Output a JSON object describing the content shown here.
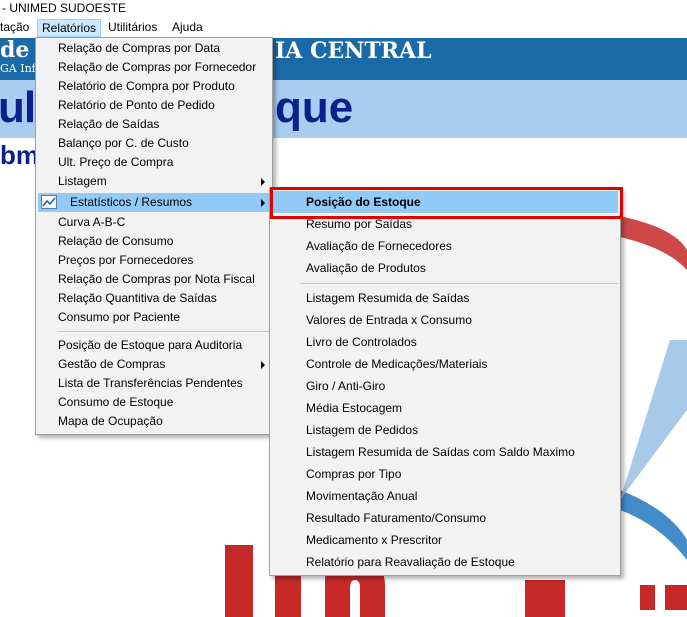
{
  "window": {
    "title": "- UNIMED SUDOESTE"
  },
  "menubar": [
    {
      "label": "tação",
      "active": false
    },
    {
      "label": "Relatórios",
      "active": true
    },
    {
      "label": "Utilitários",
      "active": false
    },
    {
      "label": "Ajuda",
      "active": false
    }
  ],
  "background": {
    "banner_left": "de d",
    "banner_right": "IA CENTRAL",
    "banner_small": "GA Infor",
    "big_left": "ulo",
    "big_right": "que",
    "subtitle": "bm"
  },
  "relatorios_menu": {
    "items": [
      {
        "label": "Relação de Compras por Data"
      },
      {
        "label": "Relação de Compras por Fornecedor"
      },
      {
        "label": "Relatório de Compra por Produto"
      },
      {
        "label": "Relatório de Ponto de Pedido"
      },
      {
        "label": "Relação de Saídas"
      },
      {
        "label": "Balanço por C. de Custo"
      },
      {
        "label": "Ult. Preço de Compra"
      },
      {
        "label": "Listagem",
        "submenu": true
      },
      {
        "label": "Estatísticos / Resumos",
        "submenu": true,
        "highlighted": true,
        "icon": "chart-icon"
      },
      {
        "label": "Curva A-B-C"
      },
      {
        "label": "Relação de Consumo"
      },
      {
        "label": "Preços por Fornecedores"
      },
      {
        "label": "Relação de Compras por Nota Fiscal"
      },
      {
        "label": "Relação Quantitiva de Saídas"
      },
      {
        "label": "Consumo por Paciente"
      },
      {
        "label": "Posição de Estoque para Auditoria"
      },
      {
        "label": "Gestão de Compras",
        "submenu": true
      },
      {
        "label": "Lista de Transferências Pendentes"
      },
      {
        "label": "Consumo de Estoque"
      },
      {
        "label": "Mapa de Ocupação"
      }
    ]
  },
  "estatisticos_submenu": {
    "items": [
      {
        "label": "Posição do Estoque",
        "highlighted": true
      },
      {
        "label": "Resumo por Saídas"
      },
      {
        "label": "Avaliação de Fornecedores"
      },
      {
        "label": "Avaliação de Produtos"
      },
      {
        "label": "Listagem Resumida de Saídas"
      },
      {
        "label": "Valores de Entrada x Consumo"
      },
      {
        "label": "Livro de Controlados"
      },
      {
        "label": "Controle de Medicações/Materiais"
      },
      {
        "label": "Giro / Anti-Giro"
      },
      {
        "label": "Média Estocagem"
      },
      {
        "label": "Listagem de Pedidos"
      },
      {
        "label": "Listagem Resumida de Saídas com Saldo Maximo"
      },
      {
        "label": "Compras por Tipo"
      },
      {
        "label": "Movimentação Anual"
      },
      {
        "label": "Resultado Faturamento/Consumo"
      },
      {
        "label": "Medicamento x Prescritor"
      },
      {
        "label": "Relatório para Reavaliação de Estoque"
      }
    ]
  },
  "colors": {
    "highlight": "#91c9f7",
    "annotation_box": "#e10000",
    "banner": "#1a6aa8",
    "title_text": "#0d1f8a"
  }
}
